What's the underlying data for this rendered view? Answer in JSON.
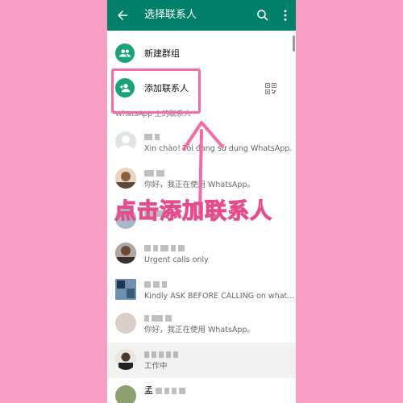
{
  "appbar": {
    "title": "选择联系人"
  },
  "actions": [
    {
      "label": "新建群组"
    },
    {
      "label": "添加联系人"
    }
  ],
  "section_title": "WhatsApp 上的联系人",
  "contacts": [
    {
      "name": "",
      "status": "Xin chào! Tôi đang sử dụng WhatsApp."
    },
    {
      "name": "",
      "status": "你好，我正在使用 WhatsApp。"
    },
    {
      "name": "",
      "status": ""
    },
    {
      "name": "",
      "status": "Urgent calls only"
    },
    {
      "name": "",
      "status": "Kindly ASK BEFORE CALLING on what..."
    },
    {
      "name": "",
      "status": "你好，我正在使用 WhatsApp。"
    },
    {
      "name": "",
      "status": "工作中"
    },
    {
      "name": "孟",
      "status": ""
    }
  ],
  "overlay": {
    "caption": "点击添加联系人"
  },
  "colors": {
    "brand": "#008069",
    "accent_green": "#1aa37a",
    "annotation_pink": "#f36ba8"
  }
}
